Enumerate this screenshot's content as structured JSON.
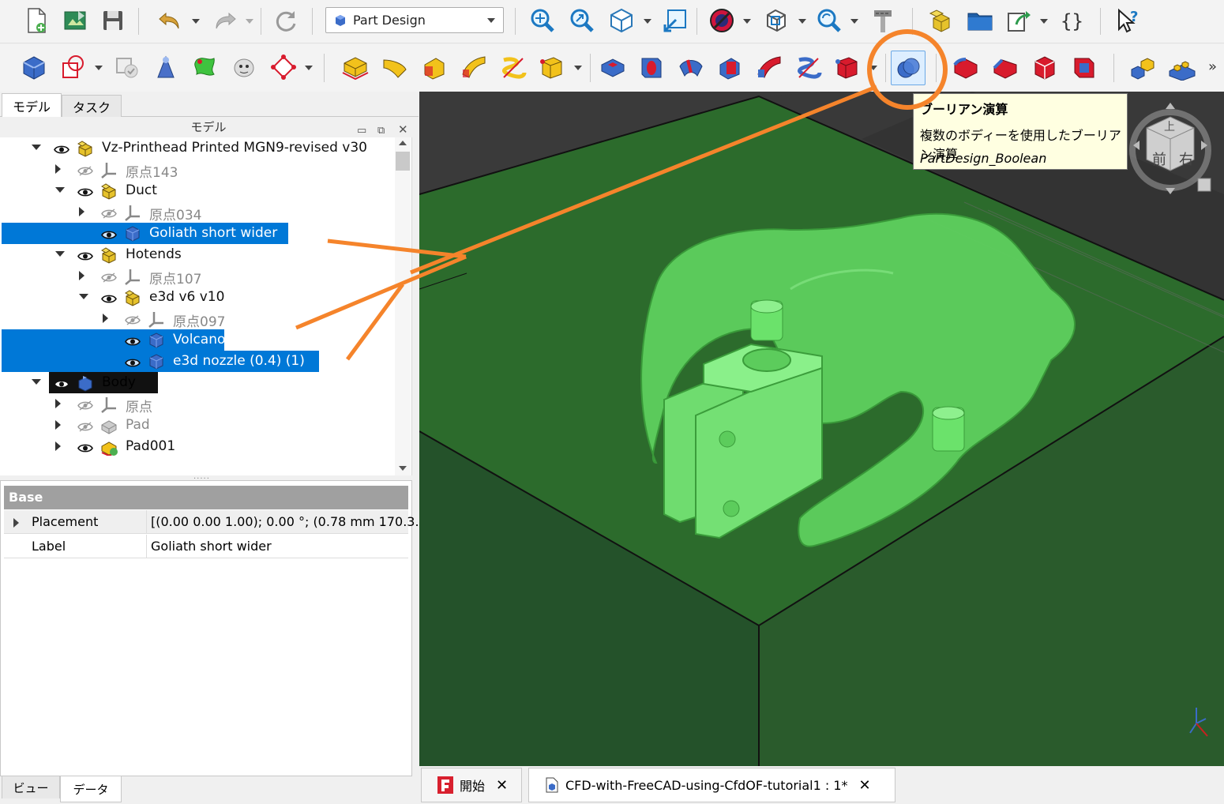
{
  "toolbar": {
    "workbench_value": "Part Design",
    "overflow_chevron": "»"
  },
  "left_panel": {
    "tabs_top": [
      "モデル",
      "タスク"
    ],
    "tree_header": "モデル",
    "tree": [
      {
        "label": "Vz-Printhead Printed MGN9-revised v30",
        "depth": 0,
        "expander": "down",
        "visible": true,
        "icon": "part-icon",
        "state": "normal"
      },
      {
        "label": "原点143",
        "depth": 1,
        "expander": "right",
        "visible": false,
        "icon": "origin-icon",
        "state": "grey"
      },
      {
        "label": "Duct",
        "depth": 1,
        "expander": "down",
        "visible": true,
        "icon": "part-icon",
        "state": "normal"
      },
      {
        "label": "原点034",
        "depth": 2,
        "expander": "right",
        "visible": false,
        "icon": "origin-icon",
        "state": "grey"
      },
      {
        "label": "Goliath short wider",
        "depth": 2,
        "expander": "none",
        "visible": true,
        "icon": "body-icon",
        "state": "selected"
      },
      {
        "label": "Hotends",
        "depth": 1,
        "expander": "down",
        "visible": true,
        "icon": "part-icon",
        "state": "normal"
      },
      {
        "label": "原点107",
        "depth": 2,
        "expander": "right",
        "visible": false,
        "icon": "origin-icon",
        "state": "grey"
      },
      {
        "label": "e3d v6 v10",
        "depth": 2,
        "expander": "down",
        "visible": true,
        "icon": "part-icon",
        "state": "normal"
      },
      {
        "label": "原点097",
        "depth": 3,
        "expander": "right",
        "visible": false,
        "icon": "origin-icon",
        "state": "grey"
      },
      {
        "label": "Volcano",
        "depth": 3,
        "expander": "none",
        "visible": true,
        "icon": "body-icon",
        "state": "selected"
      },
      {
        "label": "e3d nozzle (0.4) (1)",
        "depth": 3,
        "expander": "none",
        "visible": true,
        "icon": "body-icon",
        "state": "selected"
      },
      {
        "label": "Body",
        "depth": 0,
        "expander": "down",
        "visible": true,
        "icon": "body-active-icon",
        "state": "active"
      },
      {
        "label": "原点",
        "depth": 1,
        "expander": "right",
        "visible": false,
        "icon": "origin-icon",
        "state": "grey"
      },
      {
        "label": "Pad",
        "depth": 1,
        "expander": "right",
        "visible": false,
        "icon": "pad-icon",
        "state": "grey"
      },
      {
        "label": "Pad001",
        "depth": 1,
        "expander": "right",
        "visible": true,
        "icon": "pad-tip-icon",
        "state": "normal"
      }
    ],
    "properties": {
      "group": "Base",
      "rows": [
        {
          "key": "Placement",
          "value": "[(0.00 0.00 1.00); 0.00 °; (0.78 mm  170.3..."
        },
        {
          "key": "Label",
          "value": "Goliath short wider"
        }
      ]
    },
    "tabs_bottom": [
      "ビュー",
      "データ"
    ]
  },
  "tooltip": {
    "title": "ブーリアン演算",
    "description": "複数のボディーを使用したブーリアン演算",
    "command": "PartDesign_Boolean"
  },
  "nav_cube": {
    "top": "上",
    "front": "前",
    "right": "右"
  },
  "doc_tabs": [
    {
      "label": "開始",
      "close": "✕"
    },
    {
      "label": "CFD-with-FreeCAD-using-CfdOF-tutorial1 : 1*",
      "close": "✕"
    }
  ],
  "colors": {
    "selection": "#0078d7",
    "annotation": "#f5842b",
    "model_green": "#5fd35f",
    "viewport_bg": "#2e4a2e"
  }
}
